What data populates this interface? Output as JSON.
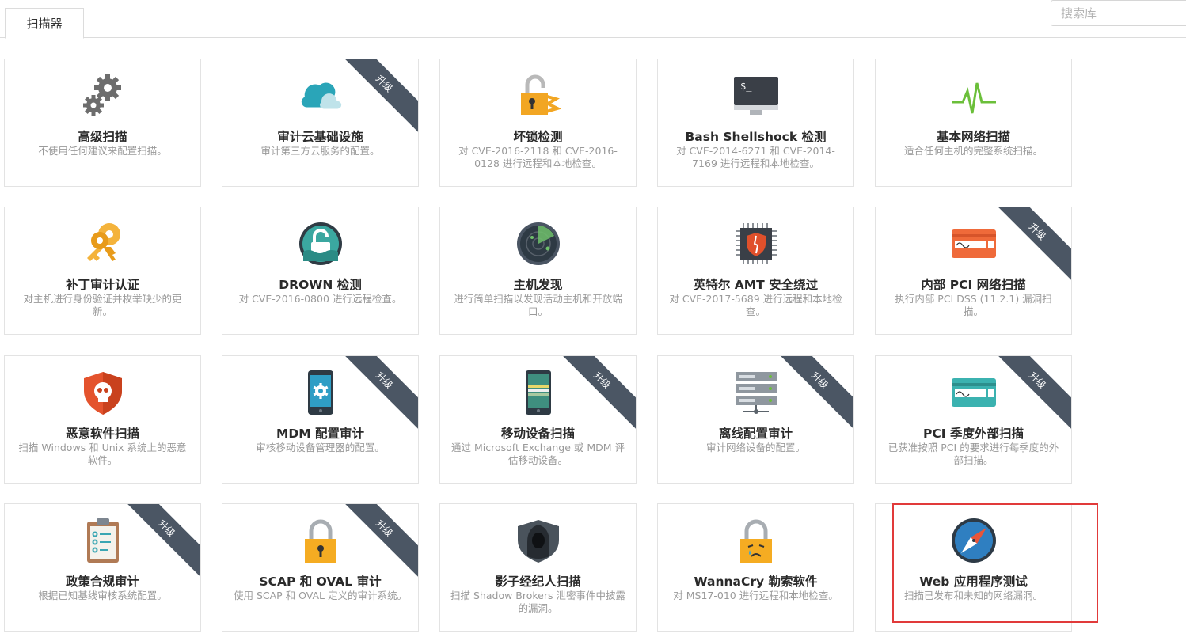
{
  "tab_label": "扫描器",
  "search": {
    "placeholder": "搜索库"
  },
  "upgrade_label": "升级",
  "cards": [
    {
      "title": "高级扫描",
      "desc": "不使用任何建议来配置扫描。",
      "icon": "gears-icon",
      "upgrade": false
    },
    {
      "title": "审计云基础设施",
      "desc": "审计第三方云服务的配置。",
      "icon": "cloud-icon",
      "upgrade": true
    },
    {
      "title": "坏锁检测",
      "desc": "对 CVE-2016-2118 和 CVE-2016-0128 进行远程和本地检查。",
      "icon": "broken-lock-icon",
      "upgrade": false
    },
    {
      "title": "Bash Shellshock 检测",
      "desc": "对 CVE-2014-6271 和 CVE-2014-7169 进行远程和本地检查。",
      "icon": "terminal-monitor-icon",
      "upgrade": false
    },
    {
      "title": "基本网络扫描",
      "desc": "适合任何主机的完整系统扫描。",
      "icon": "pulse-icon",
      "upgrade": false
    },
    {
      "title": "补丁审计认证",
      "desc": "对主机进行身份验证并枚举缺少的更新。",
      "icon": "keys-icon",
      "upgrade": false
    },
    {
      "title": "DROWN 检测",
      "desc": "对 CVE-2016-0800 进行远程检查。",
      "icon": "drown-lock-icon",
      "upgrade": false
    },
    {
      "title": "主机发现",
      "desc": "进行简单扫描以发现活动主机和开放端口。",
      "icon": "radar-icon",
      "upgrade": false
    },
    {
      "title": "英特尔 AMT 安全绕过",
      "desc": "对 CVE-2017-5689 进行远程和本地检查。",
      "icon": "chip-shield-icon",
      "upgrade": false
    },
    {
      "title": "内部 PCI 网络扫描",
      "desc": "执行内部 PCI DSS (11.2.1) 漏洞扫描。",
      "icon": "credit-card-orange-icon",
      "upgrade": true
    },
    {
      "title": "恶意软件扫描",
      "desc": "扫描 Windows 和 Unix 系统上的恶意软件。",
      "icon": "skull-shield-icon",
      "upgrade": false
    },
    {
      "title": "MDM 配置审计",
      "desc": "审核移动设备管理器的配置。",
      "icon": "phone-gear-icon",
      "upgrade": true
    },
    {
      "title": "移动设备扫描",
      "desc": "通过 Microsoft Exchange 或 MDM 评估移动设备。",
      "icon": "phone-scan-icon",
      "upgrade": true
    },
    {
      "title": "离线配置审计",
      "desc": "审计网络设备的配置。",
      "icon": "server-icon",
      "upgrade": true
    },
    {
      "title": "PCI 季度外部扫描",
      "desc": "已获准按照 PCI 的要求进行每季度的外部扫描。",
      "icon": "credit-card-teal-icon",
      "upgrade": true
    },
    {
      "title": "政策合规审计",
      "desc": "根据已知基线审核系统配置。",
      "icon": "clipboard-icon",
      "upgrade": true
    },
    {
      "title": "SCAP 和 OVAL 审计",
      "desc": "使用 SCAP 和 OVAL 定义的审计系统。",
      "icon": "padlock-icon",
      "upgrade": true
    },
    {
      "title": "影子经纪人扫描",
      "desc": "扫描 Shadow Brokers 泄密事件中披露的漏洞。",
      "icon": "hooded-figure-icon",
      "upgrade": false
    },
    {
      "title": "WannaCry 勒索软件",
      "desc": "对 MS17-010 进行远程和本地检查。",
      "icon": "crying-lock-icon",
      "upgrade": false
    },
    {
      "title": "Web 应用程序测试",
      "desc": "扫描已发布和未知的网络漏洞。",
      "icon": "compass-icon",
      "upgrade": false
    }
  ]
}
